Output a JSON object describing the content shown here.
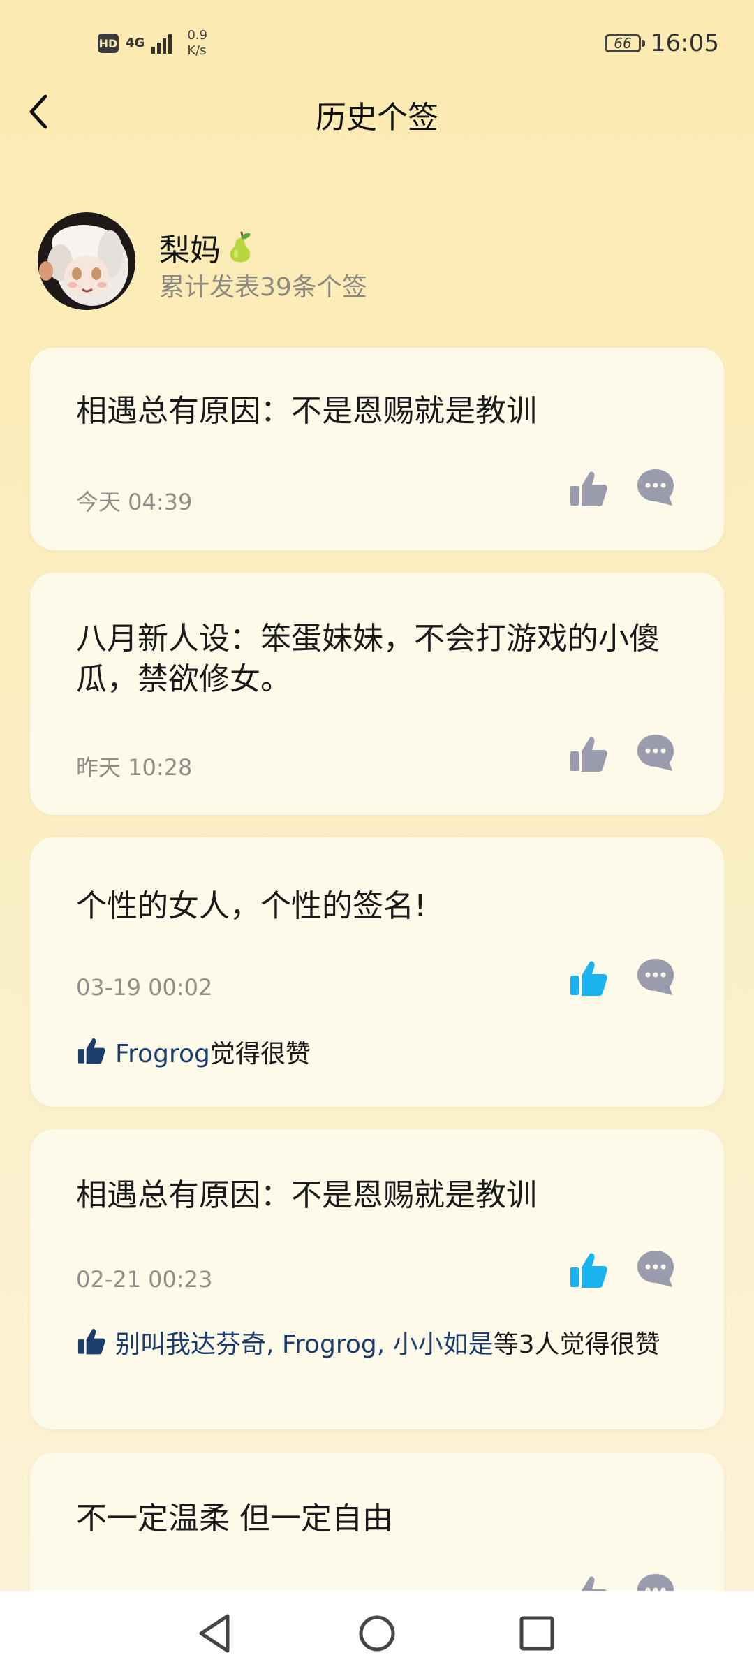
{
  "status_bar": {
    "hd": "HD",
    "network": "4G",
    "speed_value": "0.9",
    "speed_unit": "K/s",
    "battery": "66",
    "time": "16:05"
  },
  "header": {
    "title": "历史个签"
  },
  "profile": {
    "name": "梨妈",
    "subtitle": "累计发表39条个签"
  },
  "colors": {
    "like_inactive": "#9a9cae",
    "like_active": "#19b3f0",
    "names_link": "#1c3d6b"
  },
  "posts": [
    {
      "text": "相遇总有原因：不是恩赐就是教训",
      "time": "今天 04:39",
      "liked": false
    },
    {
      "text": "八月新人设：笨蛋妹妹，不会打游戏的小傻瓜，禁欲修女。",
      "time": "昨天 10:28",
      "liked": false
    },
    {
      "text": "个性的女人，个性的签名!",
      "time": "03-19 00:02",
      "liked": true,
      "likers": "Frogrog",
      "likers_suffix": "觉得很赞"
    },
    {
      "text": "相遇总有原因：不是恩赐就是教训",
      "time": "02-21 00:23",
      "liked": true,
      "likers": "别叫我达芬奇, Frogrog, 小小如是",
      "likers_suffix": "等3人觉得很赞"
    },
    {
      "text": "不一定温柔 但一定自由",
      "liked": false
    }
  ]
}
